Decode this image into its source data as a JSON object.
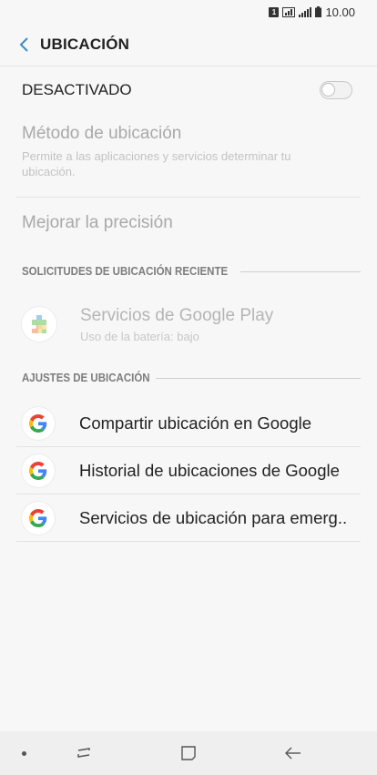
{
  "status_bar": {
    "sim": "1",
    "time": "10.00"
  },
  "header": {
    "title": "UBICACIÓN",
    "back_icon": "chevron-left-icon",
    "accent": "#3a8fbf"
  },
  "master": {
    "label": "DESACTIVADO",
    "enabled": false
  },
  "method": {
    "title": "Método de ubicación",
    "subtitle": "Permite a las aplicaciones y servicios determinar tu ubicación."
  },
  "precision": {
    "label": "Mejorar la precisión"
  },
  "recent": {
    "header": "SOLICITUDES DE UBICACIÓN RECIENTE",
    "items": [
      {
        "title": "Servicios de Google Play",
        "subtitle": "Uso de la batería: bajo",
        "icon": "google-play-services-icon"
      }
    ]
  },
  "settings": {
    "header": "AJUSTES DE UBICACIÓN",
    "items": [
      {
        "label": "Compartir ubicación en Google",
        "icon": "google-icon"
      },
      {
        "label": "Historial de ubicaciones de Google",
        "icon": "google-icon"
      },
      {
        "label": "Servicios de ubicación para emerg..",
        "icon": "google-icon"
      }
    ]
  },
  "nav_bar": {
    "icons": [
      "recent-apps-icon",
      "home-icon",
      "back-icon"
    ]
  }
}
